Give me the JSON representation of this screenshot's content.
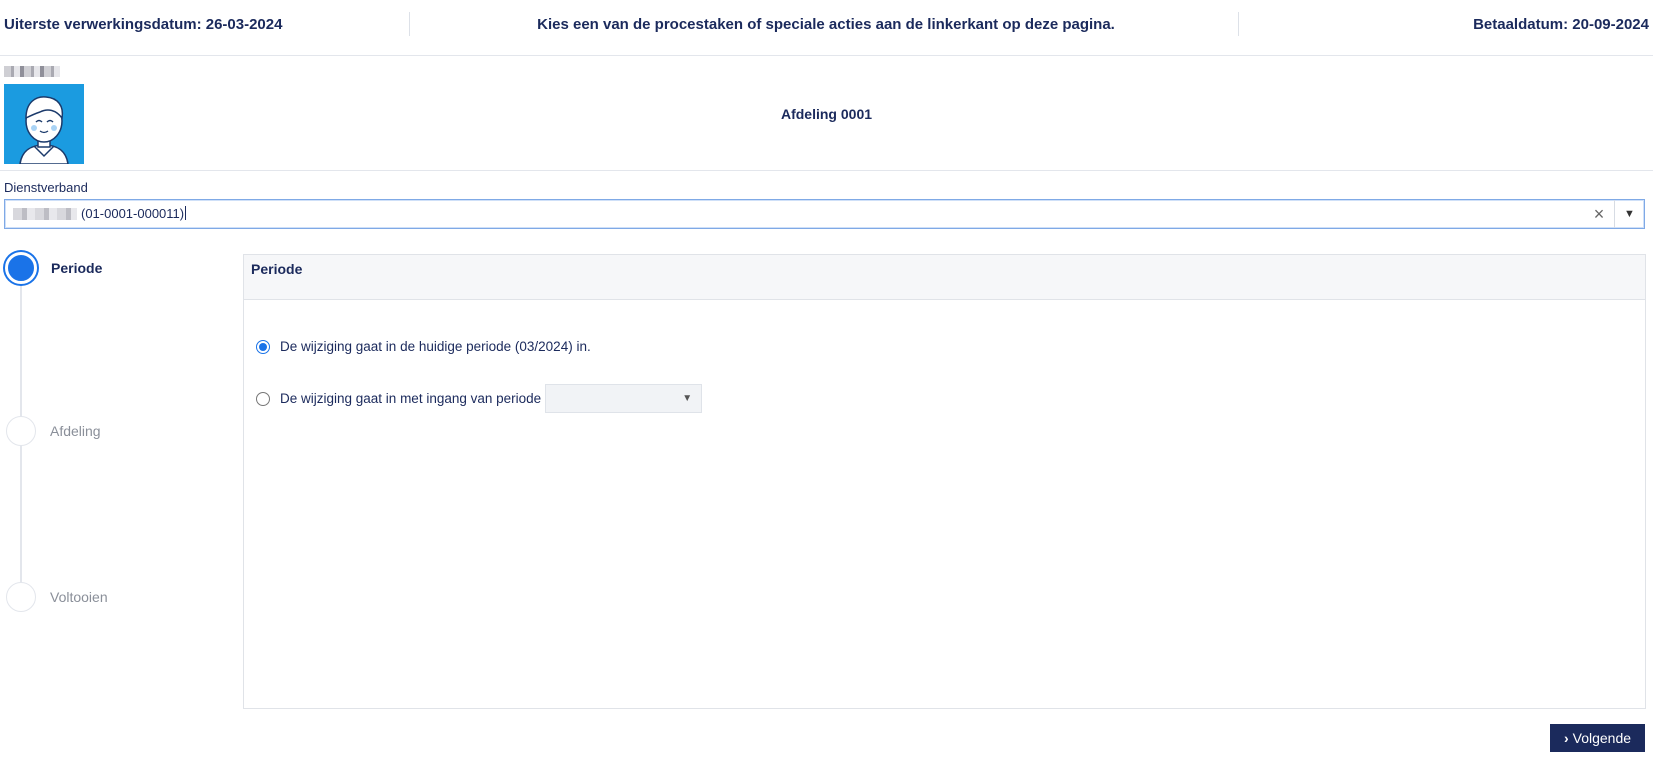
{
  "header": {
    "deadline": "Uiterste verwerkingsdatum: 26-03-2024",
    "instruction": "Kies een van de procestaken of speciale acties aan de linkerkant op deze pagina.",
    "paydate": "Betaaldatum: 20-09-2024"
  },
  "employee": {
    "department": "Afdeling 0001",
    "avatar_icon": "user-avatar-icon"
  },
  "employment": {
    "label": "Dienstverband",
    "value": "(01-0001-000011)",
    "clear_icon": "close-icon",
    "dropdown_icon": "triangle-down-icon"
  },
  "steps": [
    {
      "label": "Periode",
      "active": true
    },
    {
      "label": "Afdeling",
      "active": false
    },
    {
      "label": "Voltooien",
      "active": false
    }
  ],
  "panel": {
    "title": "Periode",
    "options": [
      {
        "label": "De wijziging gaat in de huidige periode (03/2024) in.",
        "selected": true
      },
      {
        "label": "De wijziging gaat in met ingang van periode",
        "selected": false
      }
    ],
    "period_select_value": ""
  },
  "footer": {
    "next_label": "Volgende"
  },
  "colors": {
    "primary": "#1b2a5c",
    "accent": "#1a73e8",
    "avatar_bg": "#1b9be0"
  }
}
